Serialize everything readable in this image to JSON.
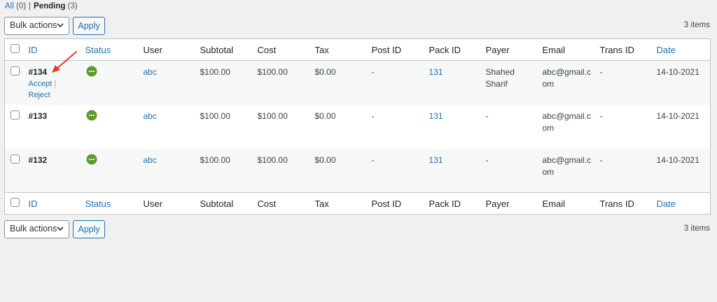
{
  "filters": {
    "all_label": "All",
    "all_count": "(0)",
    "separator": "|",
    "pending_label": "Pending",
    "pending_count": "(3)"
  },
  "tablenav_top": {
    "bulk_label": "Bulk actions",
    "apply_label": "Apply",
    "items_count": "3 items"
  },
  "tablenav_bottom": {
    "bulk_label": "Bulk actions",
    "apply_label": "Apply",
    "items_count": "3 items"
  },
  "columns": [
    "ID",
    "Status",
    "User",
    "Subtotal",
    "Cost",
    "Tax",
    "Post ID",
    "Pack ID",
    "Payer",
    "Email",
    "Trans ID",
    "Date"
  ],
  "row_actions": {
    "accept": "Accept",
    "separator": "|",
    "reject": "Reject"
  },
  "rows": [
    {
      "id": "#134",
      "user": "abc",
      "subtotal": "$100.00",
      "cost": "$100.00",
      "tax": "$0.00",
      "post_id": "-",
      "pack_id": "131",
      "payer_line1": "Shahed",
      "payer_line2": "Sharif",
      "email_line1": "abc@gmail.c",
      "email_line2": "om",
      "trans_id": "-",
      "date": "14-10-2021"
    },
    {
      "id": "#133",
      "user": "abc",
      "subtotal": "$100.00",
      "cost": "$100.00",
      "tax": "$0.00",
      "post_id": "-",
      "pack_id": "131",
      "payer_line1": "-",
      "payer_line2": "",
      "email_line1": "abc@gmail.c",
      "email_line2": "om",
      "trans_id": "-",
      "date": "14-10-2021"
    },
    {
      "id": "#132",
      "user": "abc",
      "subtotal": "$100.00",
      "cost": "$100.00",
      "tax": "$0.00",
      "post_id": "-",
      "pack_id": "131",
      "payer_line1": "-",
      "payer_line2": "",
      "email_line1": "abc@gmail.c",
      "email_line2": "om",
      "trans_id": "-",
      "date": "14-10-2021"
    }
  ],
  "colors": {
    "link": "#2271b1",
    "status_pending": "#5b9a2c",
    "arrow": "#e8372a"
  },
  "icons": {
    "status": "pending-dots-icon",
    "annotation": "red-arrow-annotation"
  }
}
